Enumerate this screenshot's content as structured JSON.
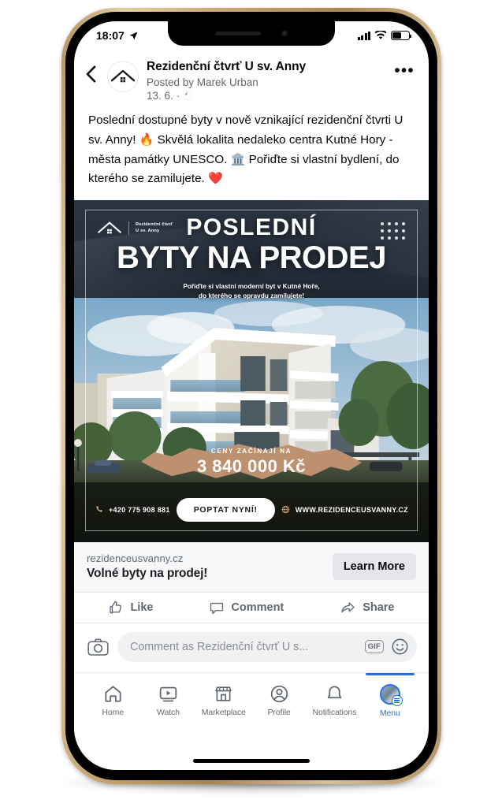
{
  "status_bar": {
    "time": "18:07",
    "location_icon": "location-arrow-icon",
    "signal_icon": "cellular-bars-icon",
    "wifi_icon": "wifi-icon",
    "battery_icon": "battery-icon"
  },
  "post": {
    "back_icon": "chevron-left-icon",
    "avatar_icon": "page-logo-house-icon",
    "page_name": "Rezidenční čtvrť U sv. Anny",
    "posted_by": "Posted by Marek Urban",
    "date": "13. 6.",
    "separator": "·",
    "privacy_icon": "globe-icon",
    "menu_icon": "more-options-icon",
    "menu_label": "•••",
    "body_line1": "Poslední dostupné byty v nově vznikající rezidenční čtvrti U sv. Anny!",
    "emoji_fire": "🔥",
    "body_line2": "Skvělá lokalita nedaleko centra Kutné Hory - města památky UNESCO.",
    "emoji_castle": "🏛️",
    "body_line3": "Pořiďte si vlastní bydlení, do kterého se zamilujete.",
    "emoji_heart": "❤️"
  },
  "creative": {
    "logo_icon": "roof-logo-icon",
    "logo_line1": "Rezidenční čtvrť",
    "logo_line2": "U sv. Anny",
    "dots_icon": "dot-grid-decoration",
    "title_line1": "POSLEDNÍ",
    "title_line2": "BYTY NA PRODEJ",
    "subtitle_line1": "Pořiďte si vlastní moderní byt v Kutné Hoře,",
    "subtitle_line2": "do kterého se opravdu zamilujete!",
    "price_label": "CENY ZAČÍNAJÍ NA",
    "price_value": "3 840 000 Kč",
    "phone_icon": "phone-icon",
    "phone": "+420 775 908 881",
    "cta_label": "POPTAT NYNÍ!",
    "web_icon": "globe-icon",
    "website": "WWW.REZIDENCEUSVANNY.CZ",
    "accent_color": "#c08f6b",
    "background_color": "#2a3340"
  },
  "link_card": {
    "domain": "rezidenceusvanny.cz",
    "title": "Volné byty na prodej!",
    "cta_label": "Learn More"
  },
  "actions": [
    {
      "label": "Like",
      "icon": "thumbs-up-icon"
    },
    {
      "label": "Comment",
      "icon": "comment-bubble-icon"
    },
    {
      "label": "Share",
      "icon": "share-arrow-icon"
    }
  ],
  "composer": {
    "camera_icon": "camera-icon",
    "placeholder": "Comment as Rezidenční čtvrť U s...",
    "gif_label": "GIF",
    "emoji_icon": "smiley-icon"
  },
  "bottom_nav": {
    "active_color": "#1b74e4",
    "items": [
      {
        "label": "Home",
        "icon": "home-icon",
        "active": false
      },
      {
        "label": "Watch",
        "icon": "watch-video-icon",
        "active": false
      },
      {
        "label": "Marketplace",
        "icon": "marketplace-storefront-icon",
        "active": false
      },
      {
        "label": "Profile",
        "icon": "profile-person-icon",
        "active": false
      },
      {
        "label": "Notifications",
        "icon": "bell-icon",
        "active": false
      },
      {
        "label": "Menu",
        "icon": "menu-avatar-icon",
        "active": true
      }
    ]
  }
}
